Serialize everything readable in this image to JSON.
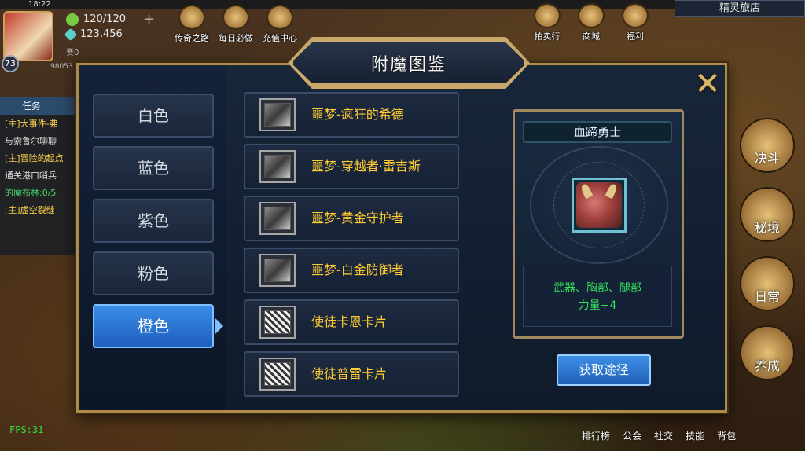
{
  "status_bar": {
    "time": "18:22"
  },
  "player": {
    "level": "73",
    "stamina": "120/120",
    "gems": "123,456",
    "sub_value": "98053",
    "rank_label": "赛0"
  },
  "top_icons": [
    {
      "label": "传奇之路",
      "icon": "legend-road-icon"
    },
    {
      "label": "每日必做",
      "icon": "daily-icon"
    },
    {
      "label": "充值中心",
      "icon": "recharge-icon"
    }
  ],
  "top_right_icons": [
    {
      "label": "拍卖行",
      "icon": "auction-icon"
    },
    {
      "label": "商城",
      "icon": "shop-icon"
    },
    {
      "label": "福利",
      "icon": "gift-icon"
    }
  ],
  "inn_title": "精灵旅店",
  "tasks": {
    "header": "任务",
    "lines": [
      {
        "text": "[主]大事件-弗",
        "style": "gold"
      },
      {
        "text": "与索鲁尔聊聊",
        "style": "white"
      },
      {
        "text": "[主]冒险的起点",
        "style": "gold"
      },
      {
        "text": "通关港口哨兵",
        "style": "white"
      },
      {
        "text": "的魔布林:0/5",
        "style": "green"
      },
      {
        "text": "[主]虚空裂缝",
        "style": "gold"
      }
    ]
  },
  "right_nav": [
    {
      "label": "决斗"
    },
    {
      "label": "秘境"
    },
    {
      "label": "日常"
    },
    {
      "label": "养成"
    }
  ],
  "bottom_nav": [
    "排行榜",
    "公会",
    "社交",
    "技能",
    "背包"
  ],
  "fps": "FPS:31",
  "dialog": {
    "title": "附魔图鉴",
    "close_glyph": "✕",
    "color_tabs": [
      {
        "label": "白色",
        "active": false
      },
      {
        "label": "蓝色",
        "active": false
      },
      {
        "label": "紫色",
        "active": false
      },
      {
        "label": "粉色",
        "active": false
      },
      {
        "label": "橙色",
        "active": true
      }
    ],
    "cards": [
      {
        "name": "噩梦-疯狂的希德",
        "thumb": "card-thumb-icon"
      },
      {
        "name": "噩梦-穿越者·雷吉斯",
        "thumb": "card-thumb-icon"
      },
      {
        "name": "噩梦-黄金守护者",
        "thumb": "card-thumb-icon"
      },
      {
        "name": "噩梦-白金防御者",
        "thumb": "card-thumb-icon"
      },
      {
        "name": "使徒卡恩卡片",
        "thumb": "apostle-card-icon"
      },
      {
        "name": "使徒普雷卡片",
        "thumb": "apostle-card-icon"
      }
    ],
    "detail": {
      "name": "血蹄勇士",
      "portrait": "blood-hoof-warrior-portrait",
      "slots": "武器、胸部、腿部",
      "stat": "力量+4"
    },
    "obtain_button": "获取途径"
  },
  "colors": {
    "accent_blue": "#2a75d4",
    "gold_text": "#ffcc33",
    "green_text": "#34e05a",
    "frame_gold": "#b08a48"
  }
}
